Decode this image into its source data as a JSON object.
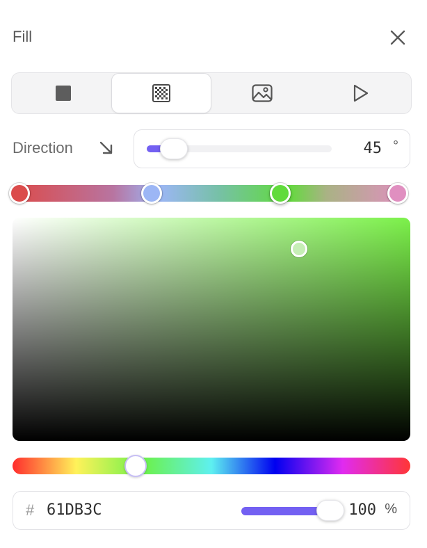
{
  "panel": {
    "title": "Fill"
  },
  "fill_types": [
    {
      "icon": "solid-square-icon",
      "active": false
    },
    {
      "icon": "gradient-icon",
      "active": true
    },
    {
      "icon": "image-icon",
      "active": false
    },
    {
      "icon": "video-play-icon",
      "active": false
    }
  ],
  "direction": {
    "label": "Direction",
    "value": "45",
    "unit": "°",
    "slider_fraction": 0.125
  },
  "gradient": {
    "stops": [
      {
        "color": "#db4c4c",
        "position": 0.0
      },
      {
        "color": "#9cb6f5",
        "position": 0.35
      },
      {
        "color": "#61db3c",
        "position": 0.69
      },
      {
        "color": "#e08fc0",
        "position": 1.0
      }
    ],
    "selected_stop": 2
  },
  "picker": {
    "hue_color": "#7cf14a",
    "saturation": 0.72,
    "value": 0.86,
    "hue_fraction": 0.31
  },
  "color": {
    "hash": "#",
    "hex": "61DB3C",
    "opacity": "100",
    "opacity_unit": "%",
    "opacity_fraction": 1.0
  },
  "colors": {
    "accent": "#7360f2"
  }
}
